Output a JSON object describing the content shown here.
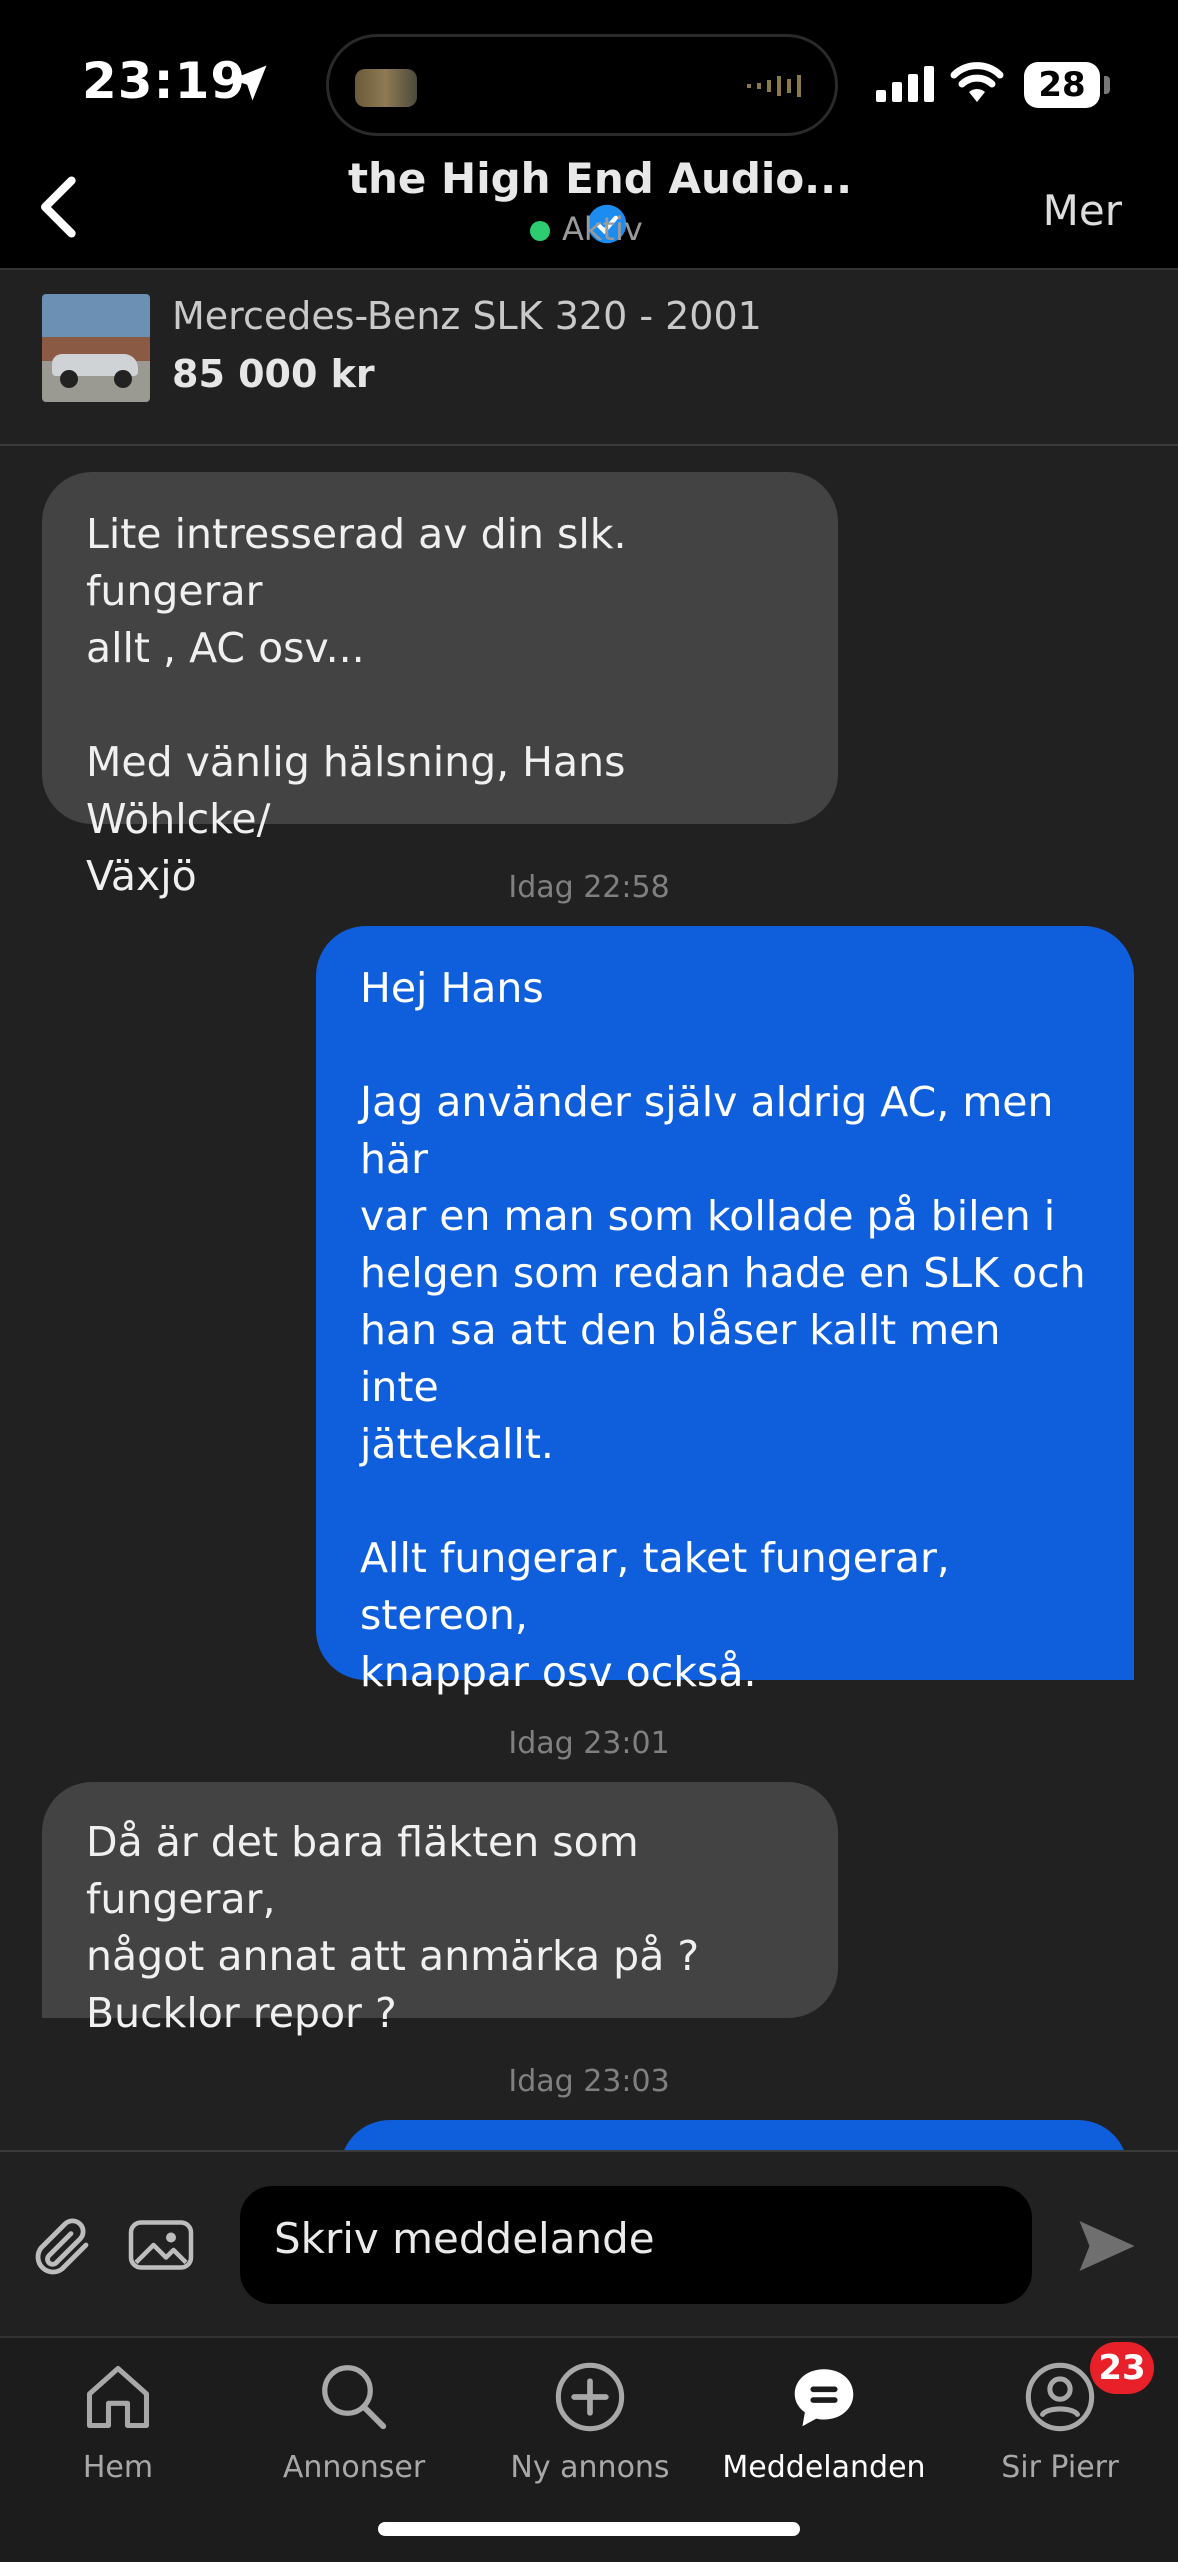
{
  "status_bar": {
    "time": "23:19",
    "battery": "28"
  },
  "header": {
    "back_icon": "chevron-left-icon",
    "title": "the High End Audio...",
    "status": "Aktiv",
    "more_label": "Mer"
  },
  "listing": {
    "title": "Mercedes-Benz SLK 320 - 2001",
    "price": "85 000 kr"
  },
  "messages": [
    {
      "direction": "in",
      "text": "Lite intresserad av din slk. fungerar\nallt , AC osv...\n\nMed vänlig hälsning, Hans Wöhlcke/\nVäxjö"
    },
    {
      "timestamp": "Idag 22:58"
    },
    {
      "direction": "out",
      "text": "Hej Hans\n\nJag använder själv aldrig AC, men här\nvar en man som kollade på bilen i\nhelgen som redan hade en SLK och\nhan sa att den blåser kallt men inte\njättekallt.\n\nAllt fungerar, taket fungerar, stereon,\nknappar osv också."
    },
    {
      "timestamp": "Idag 23:01"
    },
    {
      "direction": "in",
      "text": "Då är det bara fläkten som fungerar,\nnågot annat att anmärka på ?\nBucklor repor ?"
    },
    {
      "timestamp": "Idag 23:03"
    }
  ],
  "composer": {
    "placeholder": "Skriv meddelande"
  },
  "tabs": [
    {
      "label": "Hem",
      "icon": "home-icon"
    },
    {
      "label": "Annonser",
      "icon": "search-icon"
    },
    {
      "label": "Ny annons",
      "icon": "plus-circle-icon"
    },
    {
      "label": "Meddelanden",
      "icon": "chat-bubble-icon",
      "active": true
    },
    {
      "label": "Sir Pierr",
      "icon": "profile-icon",
      "badge": "23"
    }
  ],
  "colors": {
    "outgoing_bubble": "#0f5fdc",
    "incoming_bubble": "#434343",
    "badge": "#e8202a",
    "active_dot": "#2ecc71",
    "verified": "#1d8cf0"
  }
}
